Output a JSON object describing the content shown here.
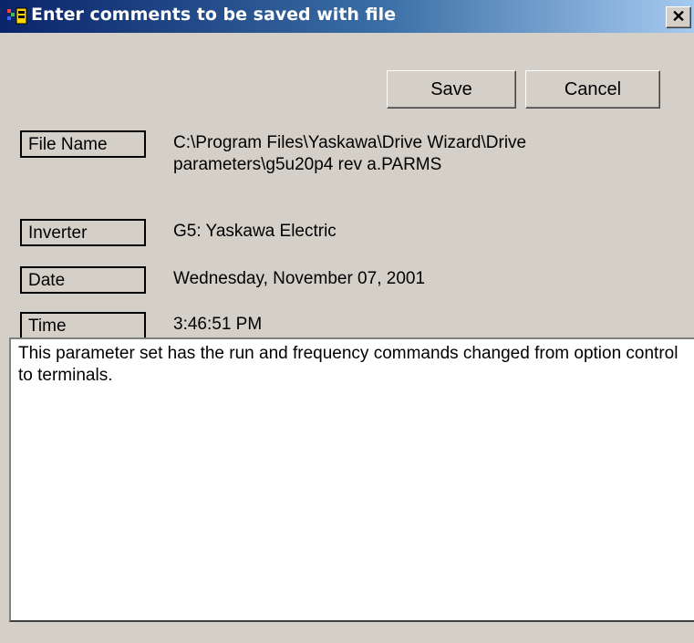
{
  "window": {
    "title": "Enter comments to be saved with file",
    "close_label": "✕"
  },
  "toolbar": {
    "save_label": "Save",
    "cancel_label": "Cancel"
  },
  "fields": {
    "file_name": {
      "label": "File Name",
      "value": "C:\\Program Files\\Yaskawa\\Drive Wizard\\Drive parameters\\g5u20p4 rev a.PARMS"
    },
    "inverter": {
      "label": "Inverter",
      "value": "G5: Yaskawa Electric"
    },
    "date": {
      "label": "Date",
      "value": "Wednesday, November 07, 2001"
    },
    "time": {
      "label": "Time",
      "value": "3:46:51 PM"
    }
  },
  "comments": {
    "text": "This parameter set has the run and frequency commands changed from option control to terminals."
  },
  "icons": {
    "app": "app-icon",
    "close": "close-icon"
  }
}
